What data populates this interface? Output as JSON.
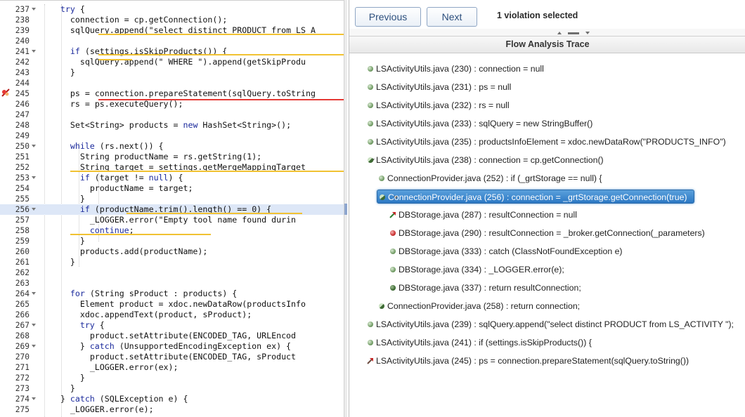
{
  "editor": {
    "lines": [
      {
        "num": "237",
        "fold": true,
        "code": "    try {"
      },
      {
        "num": "238",
        "fold": false,
        "code": "      connection = cp.getConnection();"
      },
      {
        "num": "239",
        "fold": false,
        "code": "      sqlQuery.append(\"select distinct PRODUCT from LS_A"
      },
      {
        "num": "240",
        "fold": false,
        "code": ""
      },
      {
        "num": "241",
        "fold": true,
        "code": "      if (settings.isSkipProducts()) {"
      },
      {
        "num": "242",
        "fold": false,
        "code": "        sqlQuery.append(\" WHERE \").append(getSkipProdu"
      },
      {
        "num": "243",
        "fold": false,
        "code": "      }"
      },
      {
        "num": "244",
        "fold": false,
        "code": ""
      },
      {
        "num": "245",
        "fold": false,
        "code": "      ps = connection.prepareStatement(sqlQuery.toString"
      },
      {
        "num": "246",
        "fold": false,
        "code": "      rs = ps.executeQuery();"
      },
      {
        "num": "247",
        "fold": false,
        "code": ""
      },
      {
        "num": "248",
        "fold": false,
        "code": "      Set<String> products = new HashSet<String>();"
      },
      {
        "num": "249",
        "fold": false,
        "code": ""
      },
      {
        "num": "250",
        "fold": true,
        "code": "      while (rs.next()) {"
      },
      {
        "num": "251",
        "fold": false,
        "code": "        String productName = rs.getString(1);"
      },
      {
        "num": "252",
        "fold": false,
        "code": "        String target = settings.getMergeMappingTarget"
      },
      {
        "num": "253",
        "fold": true,
        "code": "        if (target != null) {"
      },
      {
        "num": "254",
        "fold": false,
        "code": "          productName = target;"
      },
      {
        "num": "255",
        "fold": false,
        "code": "        }"
      },
      {
        "num": "256",
        "fold": true,
        "code": "        if (productName.trim().length() == 0) {"
      },
      {
        "num": "257",
        "fold": false,
        "code": "          _LOGGER.error(\"Empty tool name found durin"
      },
      {
        "num": "258",
        "fold": false,
        "code": "          continue;"
      },
      {
        "num": "259",
        "fold": false,
        "code": "        }"
      },
      {
        "num": "260",
        "fold": false,
        "code": "        products.add(productName);"
      },
      {
        "num": "261",
        "fold": false,
        "code": "      }"
      },
      {
        "num": "262",
        "fold": false,
        "code": ""
      },
      {
        "num": "263",
        "fold": false,
        "code": ""
      },
      {
        "num": "264",
        "fold": true,
        "code": "      for (String sProduct : products) {"
      },
      {
        "num": "265",
        "fold": false,
        "code": "        Element product = xdoc.newDataRow(productsInfo"
      },
      {
        "num": "266",
        "fold": false,
        "code": "        xdoc.appendText(product, sProduct);"
      },
      {
        "num": "267",
        "fold": true,
        "code": "        try {"
      },
      {
        "num": "268",
        "fold": false,
        "code": "          product.setAttribute(ENCODED_TAG, URLEncod"
      },
      {
        "num": "269",
        "fold": true,
        "code": "        } catch (UnsupportedEncodingException ex) {"
      },
      {
        "num": "270",
        "fold": false,
        "code": "          product.setAttribute(ENCODED_TAG, sProduct"
      },
      {
        "num": "271",
        "fold": false,
        "code": "          _LOGGER.error(ex);"
      },
      {
        "num": "272",
        "fold": false,
        "code": "        }"
      },
      {
        "num": "273",
        "fold": false,
        "code": "      }"
      },
      {
        "num": "274",
        "fold": true,
        "code": "    } catch (SQLException e) {"
      },
      {
        "num": "275",
        "fold": false,
        "code": "      _LOGGER.error(e);"
      }
    ],
    "keywords": [
      "try",
      "if",
      "while",
      "for",
      "catch",
      "new",
      "null",
      "continue"
    ],
    "highlighted_line": "256",
    "error_line": "245"
  },
  "panel": {
    "prev_label": "Previous",
    "next_label": "Next",
    "selection_info": "1 violation selected",
    "trace_title": "Flow Analysis Trace",
    "trace": [
      {
        "indent": 0,
        "icon": "green",
        "expander": "",
        "text": "LSActivityUtils.java (230) : connection = null"
      },
      {
        "indent": 0,
        "icon": "green",
        "expander": "",
        "text": "LSActivityUtils.java (231) : ps = null"
      },
      {
        "indent": 0,
        "icon": "green",
        "expander": "",
        "text": "LSActivityUtils.java (232) : rs = null"
      },
      {
        "indent": 0,
        "icon": "green",
        "expander": "",
        "text": "LSActivityUtils.java (233) : sqlQuery = new StringBuffer()"
      },
      {
        "indent": 0,
        "icon": "green",
        "expander": "right",
        "text": "LSActivityUtils.java (235) : productsInfoElement = xdoc.newDataRow(\"PRODUCTS_INFO\")"
      },
      {
        "indent": 0,
        "icon": "half",
        "expander": "down",
        "text": "LSActivityUtils.java (238) : connection = cp.getConnection()"
      },
      {
        "indent": 1,
        "icon": "green",
        "expander": "",
        "text": "ConnectionProvider.java (252) : if (_grtStorage == null) {"
      },
      {
        "indent": 1,
        "icon": "half",
        "expander": "down",
        "text": "ConnectionProvider.java (256) : connection = _grtStorage.getConnection(true)",
        "selected": true
      },
      {
        "indent": 2,
        "icon": "arrow",
        "expander": "",
        "text": "DBStorage.java (287) : resultConnection = null"
      },
      {
        "indent": 2,
        "icon": "red",
        "expander": "",
        "text": "DBStorage.java (290) : resultConnection = _broker.getConnection(_parameters)"
      },
      {
        "indent": 2,
        "icon": "green",
        "expander": "",
        "text": "DBStorage.java (333) : catch (ClassNotFoundException e)"
      },
      {
        "indent": 2,
        "icon": "green",
        "expander": "",
        "text": "DBStorage.java (334) : _LOGGER.error(e);"
      },
      {
        "indent": 2,
        "icon": "dark",
        "expander": "",
        "text": "DBStorage.java (337) : return resultConnection;"
      },
      {
        "indent": 1,
        "icon": "half",
        "expander": "",
        "text": "ConnectionProvider.java (258) : return connection;"
      },
      {
        "indent": 0,
        "icon": "green",
        "expander": "",
        "text": "LSActivityUtils.java (239) : sqlQuery.append(\"select distinct PRODUCT from LS_ACTIVITY \");"
      },
      {
        "indent": 0,
        "icon": "green",
        "expander": "",
        "text": "LSActivityUtils.java (241) : if (settings.isSkipProducts()) {"
      },
      {
        "indent": 0,
        "icon": "arrow-red",
        "expander": "",
        "text": "LSActivityUtils.java (245) : ps = connection.prepareStatement(sqlQuery.toString())"
      }
    ]
  },
  "colors": {
    "keyword": "#1b2a9c",
    "selection": "#2c78c4",
    "warning_underline": "#f1c232",
    "error_underline": "#e53935",
    "current_line": "#dde7f7"
  }
}
